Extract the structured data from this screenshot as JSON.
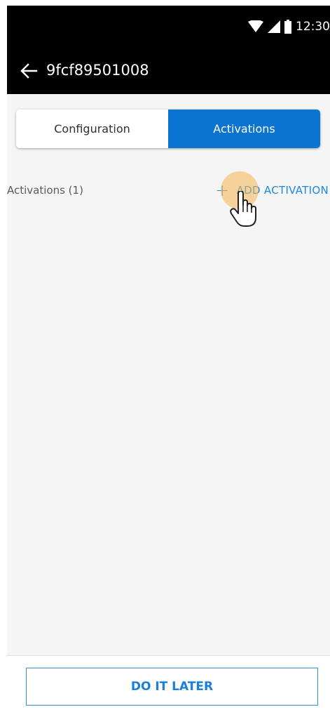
{
  "status_bar": {
    "time": "12:30",
    "icons": [
      "wifi-icon",
      "signal-icon",
      "battery-icon"
    ]
  },
  "app_bar": {
    "title": "9fcf89501008",
    "back_icon": "arrow-left-icon"
  },
  "tabs": [
    {
      "label": "Configuration",
      "active": false
    },
    {
      "label": "Activations",
      "active": true
    }
  ],
  "activations": {
    "count_label": "Activations (1)",
    "add_label": "ADD ACTIVATION",
    "add_icon": "plus-icon"
  },
  "footer": {
    "later_label": "DO IT LATER"
  },
  "colors": {
    "accent": "#0b74d1",
    "link": "#1a8ae0",
    "app_bar": "#000000",
    "background": "#f5f5f5"
  }
}
